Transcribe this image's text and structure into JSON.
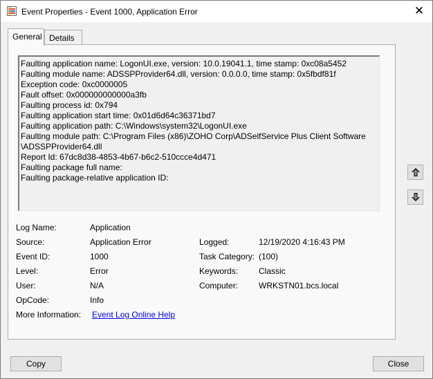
{
  "window": {
    "title": "Event Properties - Event 1000, Application Error",
    "close_symbol": "✕"
  },
  "tabs": [
    {
      "label": "General",
      "active": true
    },
    {
      "label": "Details",
      "active": false
    }
  ],
  "description_lines": [
    "Faulting application name: LogonUI.exe, version: 10.0.19041.1, time stamp: 0xc08a5452",
    "Faulting module name: ADSSPProvider64.dll, version: 0.0.0.0, time stamp: 0x5fbdf81f",
    "Exception code: 0xc0000005",
    "Fault offset: 0x000000000000a3fb",
    "Faulting process id: 0x794",
    "Faulting application start time: 0x01d6d64c36371bd7",
    "Faulting application path: C:\\Windows\\system32\\LogonUI.exe",
    "Faulting module path: C:\\Program Files (x86)\\ZOHO Corp\\ADSelfService Plus Client Software",
    "\\ADSSPProvider64.dll",
    "Report Id: 67dc8d38-4853-4b67-b6c2-510ccce4d471",
    "Faulting package full name:",
    "Faulting package-relative application ID:"
  ],
  "details": {
    "log_name_label": "Log Name:",
    "log_name": "Application",
    "source_label": "Source:",
    "source": "Application Error",
    "logged_label": "Logged:",
    "logged": "12/19/2020 4:16:43 PM",
    "event_id_label": "Event ID:",
    "event_id": "1000",
    "task_category_label": "Task Category:",
    "task_category": "(100)",
    "level_label": "Level:",
    "level": "Error",
    "keywords_label": "Keywords:",
    "keywords": "Classic",
    "user_label": "User:",
    "user": "N/A",
    "computer_label": "Computer:",
    "computer": "WRKSTN01.bcs.local",
    "opcode_label": "OpCode:",
    "opcode": "Info",
    "more_info_label": "More Information:",
    "more_info_link": "Event Log Online Help"
  },
  "buttons": {
    "copy": "Copy",
    "close": "Close"
  },
  "icons": {
    "app": "event-viewer-icon",
    "close": "close-icon",
    "up": "arrow-up-icon",
    "down": "arrow-down-icon"
  },
  "colors": {
    "link": "#0000ee",
    "background": "#f0f0f0"
  }
}
